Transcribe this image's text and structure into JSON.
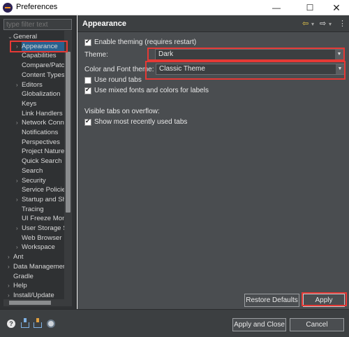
{
  "window": {
    "title": "Preferences",
    "minimize": "—",
    "maximize": "☐",
    "close": "✕"
  },
  "filter": {
    "placeholder": "type filter text"
  },
  "tree": {
    "items": [
      {
        "label": "General",
        "level": 0,
        "expanded": true
      },
      {
        "label": "Appearance",
        "level": 1,
        "expanded": false,
        "selected": true
      },
      {
        "label": "Capabilities",
        "level": 1
      },
      {
        "label": "Compare/Patch",
        "level": 1
      },
      {
        "label": "Content Types",
        "level": 1
      },
      {
        "label": "Editors",
        "level": 1,
        "expanded": false
      },
      {
        "label": "Globalization",
        "level": 1
      },
      {
        "label": "Keys",
        "level": 1
      },
      {
        "label": "Link Handlers",
        "level": 1
      },
      {
        "label": "Network Connections",
        "level": 1,
        "expanded": false
      },
      {
        "label": "Notifications",
        "level": 1
      },
      {
        "label": "Perspectives",
        "level": 1
      },
      {
        "label": "Project Natures",
        "level": 1
      },
      {
        "label": "Quick Search",
        "level": 1
      },
      {
        "label": "Search",
        "level": 1
      },
      {
        "label": "Security",
        "level": 1,
        "expanded": false
      },
      {
        "label": "Service Policies",
        "level": 1
      },
      {
        "label": "Startup and Shutdown",
        "level": 1,
        "expanded": false
      },
      {
        "label": "Tracing",
        "level": 1
      },
      {
        "label": "UI Freeze Monitoring",
        "level": 1
      },
      {
        "label": "User Storage Service",
        "level": 1,
        "expanded": false
      },
      {
        "label": "Web Browser",
        "level": 1
      },
      {
        "label": "Workspace",
        "level": 1,
        "expanded": false
      },
      {
        "label": "Ant",
        "level": 0,
        "expanded": false
      },
      {
        "label": "Data Management",
        "level": 0,
        "expanded": false
      },
      {
        "label": "Gradle",
        "level": 0
      },
      {
        "label": "Help",
        "level": 0,
        "expanded": false
      },
      {
        "label": "Install/Update",
        "level": 0,
        "expanded": false
      }
    ]
  },
  "page": {
    "title": "Appearance",
    "enable_theming": {
      "label": "Enable theming (requires restart)",
      "checked": true
    },
    "theme": {
      "label": "Theme:",
      "value": "Dark"
    },
    "color_font_theme": {
      "label": "Color and Font theme:",
      "value": "Classic Theme"
    },
    "round_tabs": {
      "label": "Use round tabs",
      "checked": false
    },
    "mixed_fonts": {
      "label": "Use mixed fonts and colors for labels",
      "checked": true
    },
    "visible_tabs_heading": "Visible tabs on overflow:",
    "show_recent": {
      "label": "Show most recently used tabs",
      "checked": true
    },
    "restore_defaults": "Restore Defaults",
    "apply": "Apply"
  },
  "nav": {
    "back": "⇦",
    "forward": "⇨",
    "dropdown": "▾",
    "menu": "⋮"
  },
  "footer": {
    "help_icon": "?",
    "apply_and_close": "Apply and Close",
    "cancel": "Cancel"
  },
  "colors": {
    "highlight": "#e53935",
    "selection": "#27618f",
    "panel_bg": "#4a4d50",
    "tree_bg": "#2f3133"
  }
}
